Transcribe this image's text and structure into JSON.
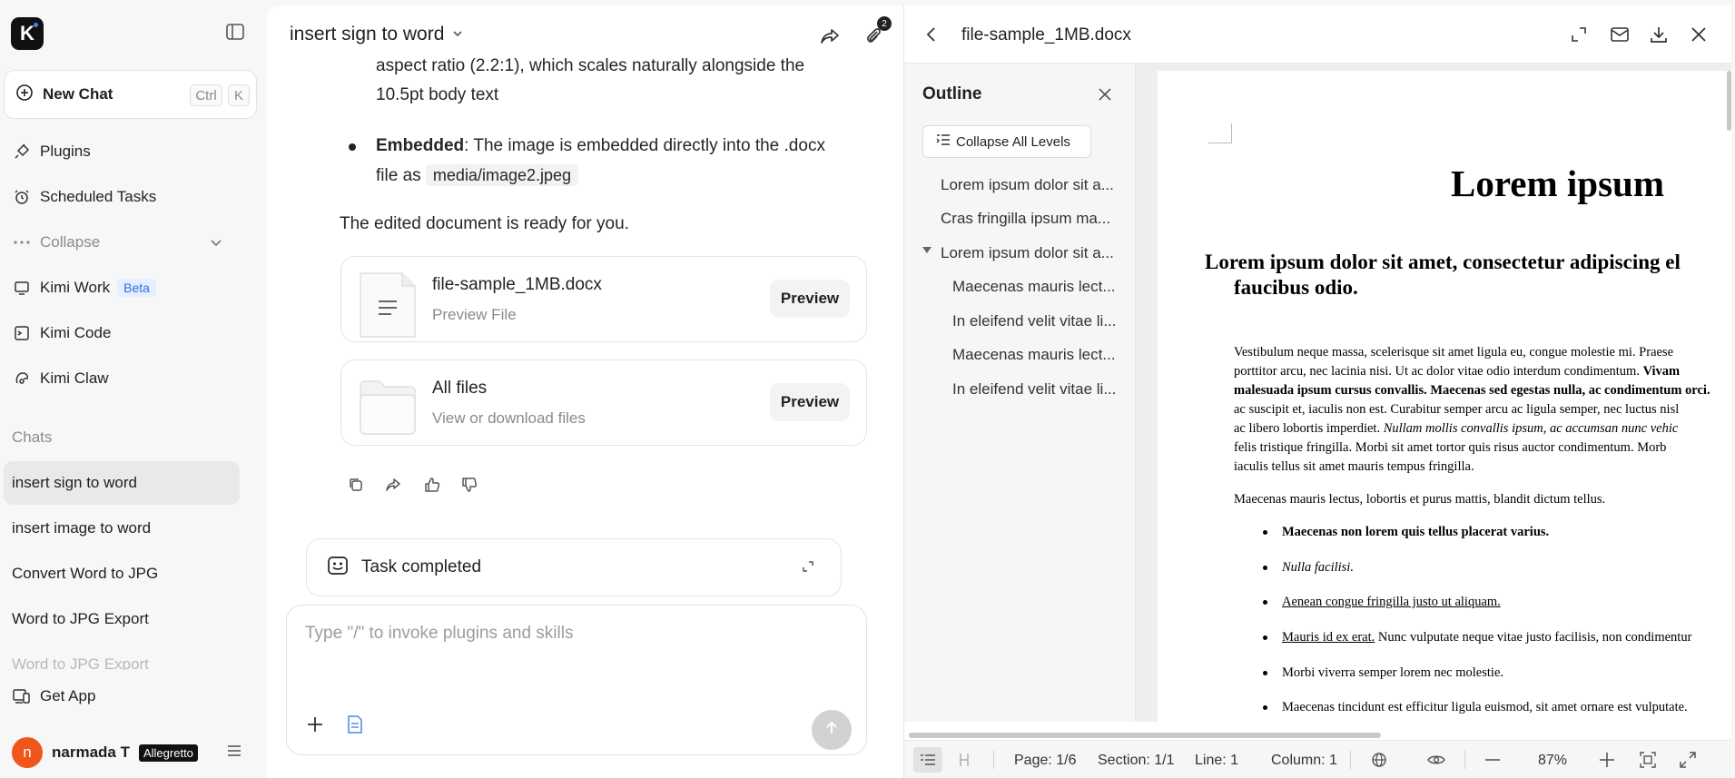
{
  "sidebar": {
    "logo_letter": "K",
    "new_chat": {
      "label": "New Chat",
      "shortcut_ctrl": "Ctrl",
      "shortcut_key": "K"
    },
    "nav": [
      {
        "label": "Plugins",
        "icon": "plugin-icon"
      },
      {
        "label": "Scheduled Tasks",
        "icon": "alarm-clock-icon"
      },
      {
        "label": "Collapse",
        "icon": "ellipsis-icon"
      },
      {
        "label": "Kimi Work",
        "icon": "monitor-icon",
        "badge": "Beta"
      },
      {
        "label": "Kimi Code",
        "icon": "terminal-icon"
      },
      {
        "label": "Kimi Claw",
        "icon": "claw-icon"
      }
    ],
    "chats_label": "Chats",
    "chats": [
      {
        "title": "insert sign to word",
        "active": true
      },
      {
        "title": "insert image to word",
        "active": false
      },
      {
        "title": "Convert Word to JPG",
        "active": false
      },
      {
        "title": "Word to JPG Export",
        "active": false
      },
      {
        "title": "Word to JPG Export",
        "active": false
      }
    ],
    "get_app": "Get App",
    "user": {
      "initial": "n",
      "name": "narmada T",
      "plan": "Allegretto"
    }
  },
  "chat": {
    "title": "insert sign to word",
    "attachment_count": "2",
    "message": {
      "line1": "aspect ratio (2.2:1), which scales naturally alongside the",
      "line2": "10.5pt body text",
      "embedded_label": "Embedded",
      "embedded_rest": ": The image is embedded directly into the .docx",
      "embedded_line2": "file as",
      "embedded_code": "media/image2.jpeg",
      "closing": "The edited document is ready for you."
    },
    "files": [
      {
        "name": "file-sample_1MB.docx",
        "sub": "Preview File",
        "button": "Preview"
      },
      {
        "name": "All files",
        "sub": "View or download files",
        "button": "Preview"
      }
    ],
    "task_status": "Task completed",
    "composer": {
      "placeholder": "Type \"/\" to invoke plugins and skills"
    }
  },
  "preview": {
    "title": "file-sample_1MB.docx",
    "outline": {
      "title": "Outline",
      "collapse_label": "Collapse All Levels",
      "items": [
        "Lorem ipsum dolor sit a...",
        "Cras fringilla ipsum ma...",
        "Lorem ipsum dolor sit a...",
        "Maecenas mauris lect...",
        "In eleifend velit vitae li...",
        "Maecenas mauris lect...",
        "In eleifend velit vitae li..."
      ]
    },
    "document": {
      "h1": "Lorem ipsum",
      "h2_line1": "Lorem ipsum dolor sit amet, consectetur adipiscing el",
      "h2_line2": "faucibus odio.",
      "para1": [
        "Vestibulum neque massa, scelerisque sit amet ligula eu, congue molestie mi. Praese",
        "porttitor arcu, nec lacinia nisi. Ut ac dolor vitae odio interdum condimentum.",
        "malesuada ipsum cursus convallis. Maecenas sed egestas nulla, ac condimentum orci.",
        "ac suscipit et, iaculis non est. Curabitur semper arcu ac ligula semper, nec luctus nisl",
        "ac libero lobortis imperdiet.",
        "felis tristique fringilla. Morbi sit amet tortor quis risus auctor condimentum. Morb",
        "iaculis tellus sit amet mauris tempus fringilla."
      ],
      "para1_bold_tail": "Vivam",
      "para1_italic_tail": "Nullam mollis convallis ipsum, ac accumsan nunc vehic",
      "para2": "Maecenas mauris lectus, lobortis et purus mattis, blandit dictum tellus.",
      "list": [
        "Maecenas non lorem quis tellus placerat varius.",
        "Nulla facilisi.",
        "Aenean congue fringilla justo ut aliquam.",
        "Mauris id ex erat.",
        "Morbi viverra semper lorem nec molestie.",
        "Maecenas tincidunt est efficitur ligula euismod, sit amet ornare est vulputate."
      ],
      "list4_tail": " Nunc vulputate neque vitae justo facilisis, non condimentur"
    },
    "status": {
      "page": "Page: 1/6",
      "section": "Section: 1/1",
      "line": "Line: 1",
      "column": "Column: 1",
      "zoom": "87%"
    }
  }
}
